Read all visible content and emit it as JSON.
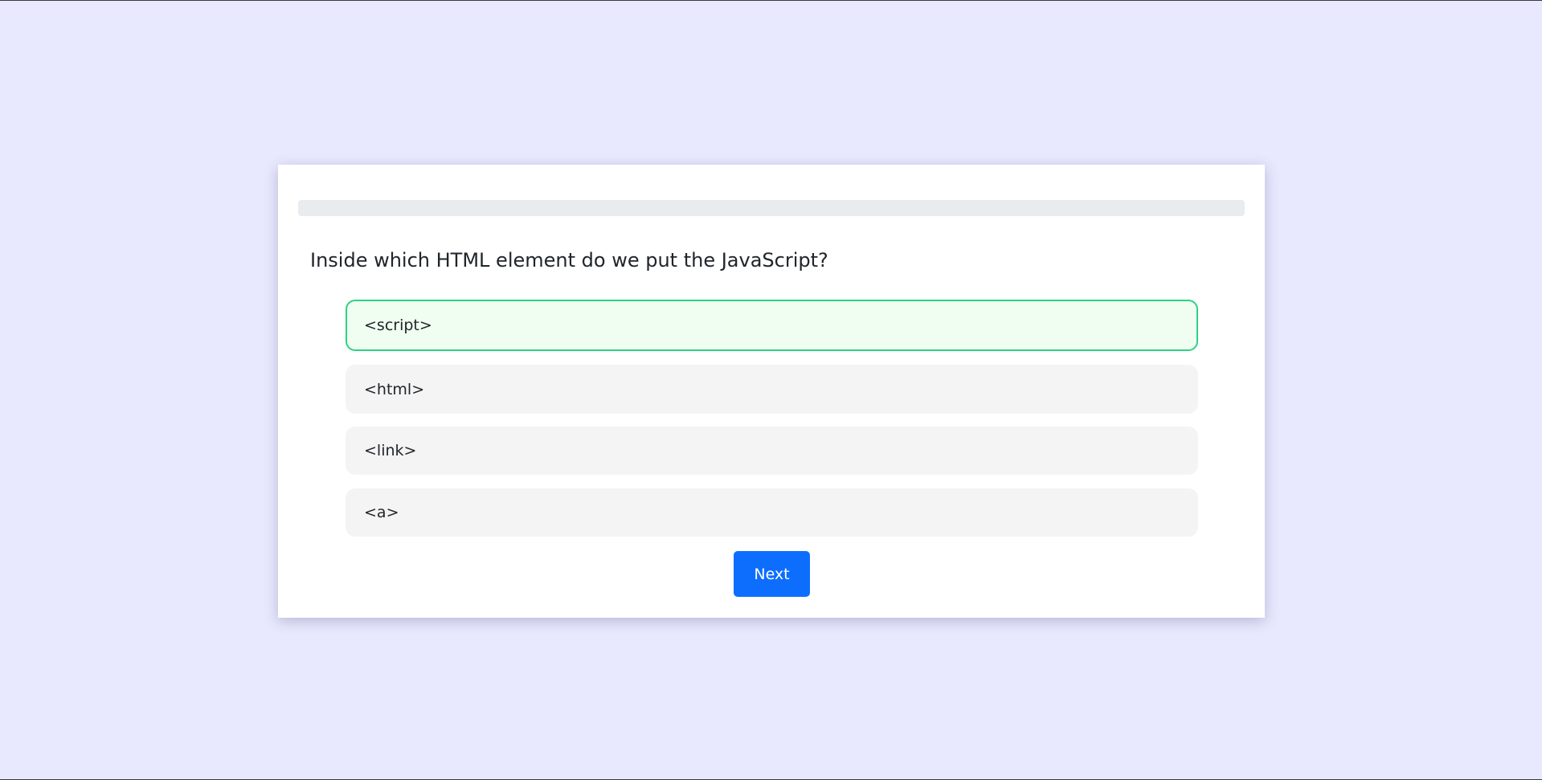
{
  "quiz": {
    "progress": 0,
    "question": "Inside which HTML element do we put the JavaScript?",
    "options": [
      {
        "label": "<script>",
        "selected": true
      },
      {
        "label": "<html>",
        "selected": false
      },
      {
        "label": "<link>",
        "selected": false
      },
      {
        "label": "<a>",
        "selected": false
      }
    ],
    "next_label": "Next"
  },
  "colors": {
    "page_background": "#e8e8fe",
    "card_background": "#ffffff",
    "progress_track": "#e9ecef",
    "option_background": "#f4f4f4",
    "selected_background": "#f0fdf1",
    "selected_border": "#2dd284",
    "primary_button": "#0d6efd"
  }
}
